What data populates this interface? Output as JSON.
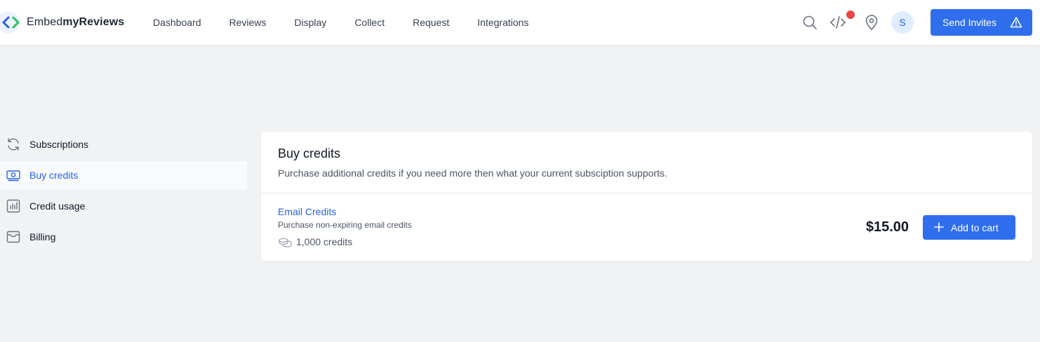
{
  "brand": {
    "name_light": "Embed",
    "name_bold": "myReviews"
  },
  "nav": [
    {
      "label": "Dashboard"
    },
    {
      "label": "Reviews"
    },
    {
      "label": "Display"
    },
    {
      "label": "Collect"
    },
    {
      "label": "Request"
    },
    {
      "label": "Integrations"
    }
  ],
  "header": {
    "icons": [
      "search-icon",
      "code-icon",
      "location-pin-icon"
    ],
    "avatar_initial": "S",
    "send_invites_label": "Send Invites"
  },
  "sidebar": {
    "items": [
      {
        "label": "Subscriptions",
        "icon": "refresh-icon"
      },
      {
        "label": "Buy credits",
        "icon": "money-icon",
        "active": true
      },
      {
        "label": "Credit usage",
        "icon": "bar-chart-icon"
      },
      {
        "label": "Billing",
        "icon": "inbox-icon"
      }
    ]
  },
  "main": {
    "title": "Buy credits",
    "subtitle": "Purchase additional credits if you need more then what your current subsciption supports.",
    "product": {
      "name": "Email Credits",
      "description": "Purchase non-expiring email credits",
      "credits": "1,000 credits",
      "price": "$15.00",
      "button_label": "Add to cart"
    }
  },
  "colors": {
    "accent": "#2f6fed",
    "link": "#2563eb",
    "notification": "#ef4444",
    "background": "#f1f2f4"
  }
}
